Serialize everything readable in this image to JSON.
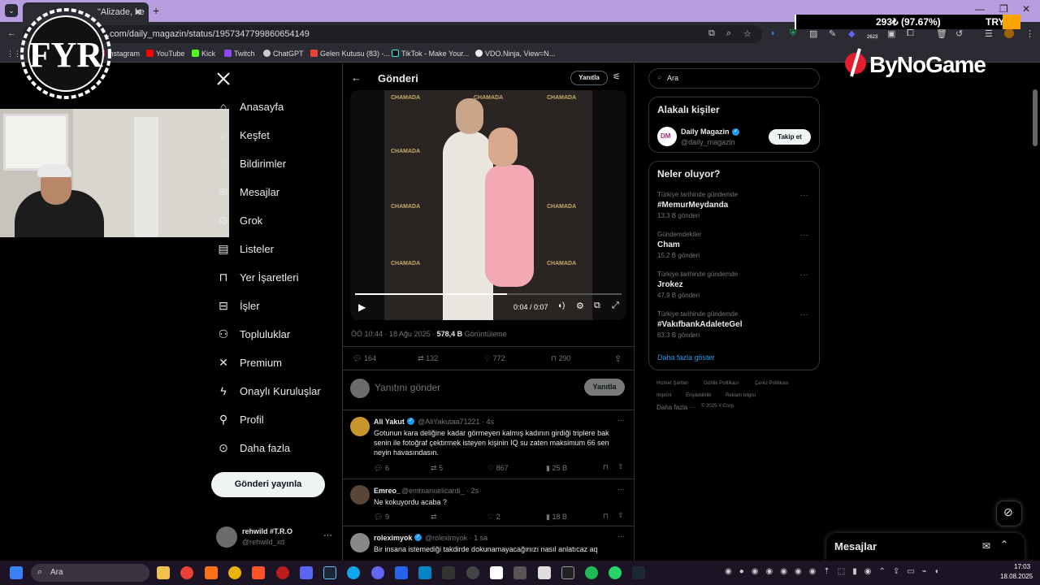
{
  "browser": {
    "tab_title": "\"Alizade, ke",
    "url": ".com/daily_magazin/status/1957347799860654149",
    "bookmarks": [
      "Instagram",
      "YouTube",
      "Kick",
      "Twitch",
      "ChatGPT",
      "Gelen Kutusu (83) -...",
      "TikTok - Make Your...",
      "VDO.Ninja, View=N..."
    ],
    "ext_badge": "2623"
  },
  "overlay": {
    "price_change": "293₺ (97.67%)",
    "price": "TRY300",
    "sponsor": "ByNoGame",
    "streamer_logo": "FYR"
  },
  "nav": {
    "items": [
      "Anasayfa",
      "Keşfet",
      "Bildirimler",
      "Mesajlar",
      "Grok",
      "Listeler",
      "Yer İşaretleri",
      "İşler",
      "Topluluklar",
      "Premium",
      "Onaylı Kuruluşlar",
      "Profil",
      "Daha fazla"
    ],
    "post_button": "Gönderi yayınla",
    "profile_name": "rehwild #T.R.O",
    "profile_handle": "@rehwild_xd"
  },
  "post": {
    "header": "Gönderi",
    "reply_chip": "Yanıtla",
    "video_time": "0:04 / 0:07",
    "video_progress": 0.57,
    "meta_time": "ÖÖ 10:44 · 18 Ağu 2025 · ",
    "views": "578,4 B",
    "views_label": "Görüntüleme",
    "replies": "164",
    "reposts": "132",
    "likes": "772",
    "bookmarks": "290",
    "reply_placeholder": "Yanıtını gönder",
    "reply_button": "Yanıtla",
    "banner_text": "CHAMADA"
  },
  "replies": [
    {
      "name": "Ali Yakut",
      "handle": "@AliYakutaa71221 · 4s",
      "text": "Gotunun kara deliğine kadar görmeyen kalmış kadının girdiği triplere bak senin ile fotoğraf çektirmek isteyen kişinin IQ su zaten maksimum 66 sen neyin havasındasın.",
      "replies": "6",
      "reposts": "5",
      "likes": "867",
      "views": "25 B"
    },
    {
      "name": "Emreo_",
      "handle": "@emmanuelicardi_ · 2s",
      "text": "Ne kokuyordu acaba ?",
      "replies": "9",
      "reposts": "",
      "likes": "2",
      "views": "18 B"
    },
    {
      "name": "roleximyok",
      "handle": "@roleximyok · 1 sa",
      "text": "Bir insana istemediği takdirde dokunamayacağınızı nasıl anlatıcaz aq"
    }
  ],
  "sidebar": {
    "search_placeholder": "Ara",
    "related_title": "Alakalı kişiler",
    "person_name": "Daily Magazin",
    "person_handle": "@daily_magazin",
    "follow": "Takip et",
    "trends_title": "Neler oluyor?",
    "trends": [
      {
        "context": "Türkiye tarihinde gündemde",
        "title": "#MemurMeydanda",
        "count": "13,3 B gönderi"
      },
      {
        "context": "Gündemdekiler",
        "title": "Cham",
        "count": "15,2 B gönderi"
      },
      {
        "context": "Türkiye tarihinde gündemde",
        "title": "Jrokez",
        "count": "47,9 B gönderi"
      },
      {
        "context": "Türkiye tarihinde gündemde",
        "title": "#VakıfbankAdaleteGel",
        "count": "63,3 B gönderi"
      }
    ],
    "show_more": "Daha fazla göster",
    "footer": [
      "Hizmet Şartları",
      "Gizlilik Politikası",
      "Çerez Politikası",
      "Imprint",
      "Erişilebilirlik",
      "Reklam bilgisi",
      "Daha fazla ···",
      "© 2025 X Corp."
    ]
  },
  "messages": {
    "title": "Mesajlar"
  },
  "taskbar": {
    "search": "Ara",
    "time": "17:03",
    "date": "18.08.2025"
  },
  "colors": {
    "accent": "#1d9bf0",
    "verified": "#1d9bf0",
    "tab_bar": "#b89ee0"
  }
}
